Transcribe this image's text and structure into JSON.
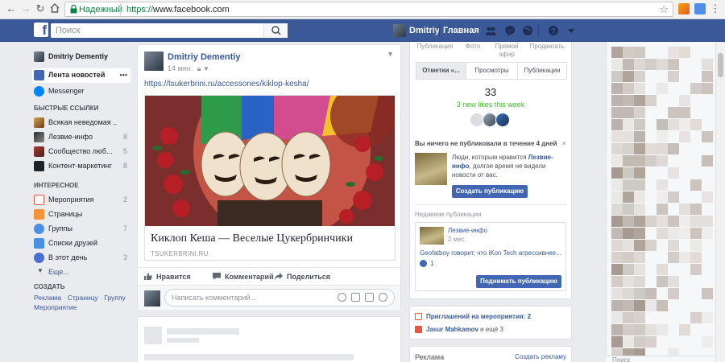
{
  "browser": {
    "secure_label": "Надежный",
    "url_scheme": "https://",
    "url_rest": "www.facebook.com"
  },
  "fb_header": {
    "search_placeholder": "Поиск",
    "user_name": "Dmitriy",
    "home_label": "Главная"
  },
  "left_sidebar": {
    "profile_name": "Dmitriy Dementiy",
    "news_feed": "Лента новостей",
    "messenger": "Messenger",
    "quick_links_title": "БЫСТРЫЕ ССЫЛКИ",
    "quick_links": [
      {
        "label": "Всякая неведомая ...",
        "count": ""
      },
      {
        "label": "Лезвие-инфо",
        "count": "8"
      },
      {
        "label": "Сообщество люб...",
        "count": "5"
      },
      {
        "label": "Контент-маркетинг",
        "count": "8"
      }
    ],
    "interesting_title": "ИНТЕРЕСНОЕ",
    "interesting": [
      {
        "label": "Мероприятия",
        "count": "2"
      },
      {
        "label": "Страницы",
        "count": ""
      },
      {
        "label": "Группы",
        "count": "7"
      },
      {
        "label": "Списки друзей",
        "count": ""
      },
      {
        "label": "В этот день",
        "count": "3"
      },
      {
        "label": "Еще...",
        "count": ""
      }
    ],
    "create_title": "СОЗДАТЬ",
    "create_links": [
      "Реклама",
      "Страницу",
      "Группу",
      "Мероприятие"
    ],
    "create_sep": "·"
  },
  "post": {
    "author": "Dmitriy Dementiy",
    "time": "14 мин.",
    "link_url": "https://tsukerbrini.ru/accessories/kiklop-kesha/",
    "link_title": "Киклоп Кеша — Веселые Цукербринчики",
    "link_domain": "TSUKERBRINI.RU",
    "actions": [
      "Нравится",
      "Комментарий",
      "Поделиться"
    ],
    "comment_placeholder": "Написать комментарий..."
  },
  "right_panel": {
    "top_items": [
      "Публикация",
      "Фото",
      "Прямой\nэфир",
      "Продвигать"
    ],
    "tabs": [
      "Отметки «...",
      "Просмотры",
      "Публикации"
    ],
    "stat_number": "33",
    "stat_likes": "3 new likes this week",
    "no_pub_title": "Вы ничего не публиковали в течение 4 дней",
    "no_pub_close": "×",
    "no_pub_text_a": "Люди, которым нравится ",
    "no_pub_text_link": "Лезвие-инфо",
    "no_pub_text_b": ", долгое время не видели новости от вас.",
    "create_pub_btn": "Создать публикацию",
    "recent_label": "Недавние публикации",
    "recent_page": "Лезвие-инфо",
    "recent_time": "2 мес.",
    "recent_text": "Geofatboy говорит, что iKon Tech агрессивнее...",
    "recent_likes": "1",
    "boost_btn": "Поднимать публикацию"
  },
  "events": {
    "title": "Приглашений на мероприятия: 2",
    "sub_name": "Jasur Mahkamov",
    "sub_rest": " и ещё 3"
  },
  "ads": {
    "title": "Реклама",
    "create": "Создать рекламу"
  },
  "chat": {
    "search_label": "Поиск"
  }
}
